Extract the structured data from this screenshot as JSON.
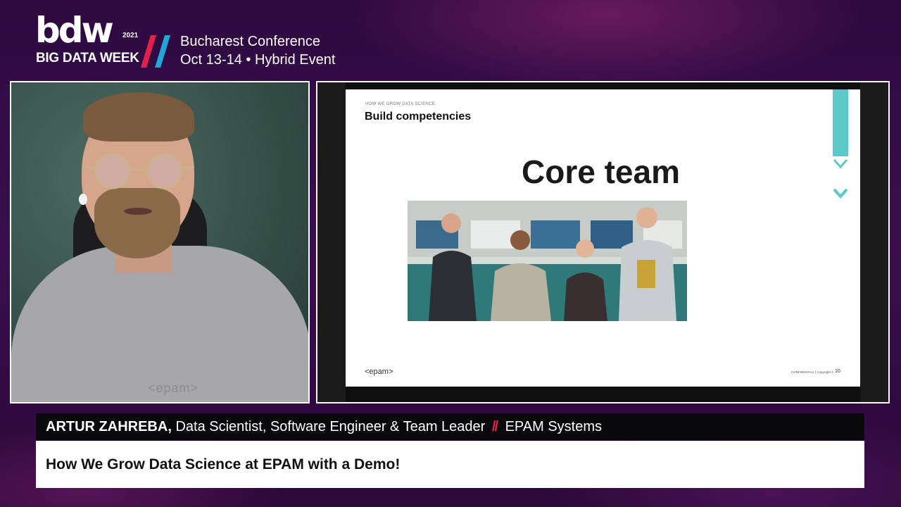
{
  "event": {
    "logo_mark": "bdw",
    "logo_year": "2021",
    "logo_subtitle": "BIG DATA WEEK",
    "conference_title": "Bucharest Conference",
    "conference_subtitle": "Oct 13-14 • Hybrid Event",
    "colors": {
      "slash_red": "#e0224a",
      "slash_blue": "#1fa7d8",
      "background": "#2e0a40"
    }
  },
  "video": {
    "shirt_logo_text": "<epam>"
  },
  "slide": {
    "section_label": "HOW WE GROW DATA SCIENCE",
    "heading": "Build competencies",
    "main_text": "Core team",
    "logo_text": "<epam>",
    "footer_text": "CONFIDENTIAL | Copyright ©",
    "page_number": "10",
    "accent_color": "#5cc8c8",
    "deco_icons": [
      "chevron-down-icon",
      "chevron-down-icon"
    ]
  },
  "lower_third": {
    "speaker_name": "ARTUR ZAHREBA,",
    "speaker_role": "Data Scientist, Software Engineer & Team Leader",
    "separator": "//",
    "company": "EPAM Systems",
    "talk_title": "How We Grow Data Science at EPAM with a Demo!"
  }
}
